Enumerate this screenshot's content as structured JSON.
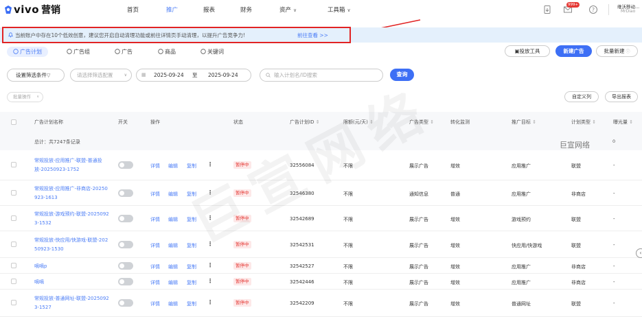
{
  "brand": {
    "logo_text": "vivo",
    "logo_text2": "营销"
  },
  "nav": {
    "items": [
      "首页",
      "推广",
      "报表",
      "财务",
      "资产",
      "工具箱"
    ],
    "notif_badge": "999+",
    "user_name": "维沃移动...",
    "user_sub": "MrDiao"
  },
  "banner": {
    "message": "当前账户中存在10个低效创意，建议您开启自动清理功能或前往详情页手动清理，以提升广告竞争力!",
    "link": "前往查看 >>"
  },
  "tabs": [
    "广告计划",
    "广告组",
    "广告",
    "商品",
    "关键词"
  ],
  "actions": {
    "tool": "投放工具",
    "new_ad": "新建广告",
    "batch_new": "批量新建"
  },
  "filters": {
    "set_condition": "设置筛选条件",
    "config_placeholder": "请选择筛选配置",
    "date_start": "2025-09-24",
    "date_to": "至",
    "date_end": "2025-09-24",
    "search_placeholder": "输入计划名/ID搜索",
    "query": "查询"
  },
  "toolbar": {
    "batch_op": "批量操作",
    "custom_cols": "自定义列",
    "export": "导出报表"
  },
  "table": {
    "headers": [
      "广告计划名称",
      "开关",
      "操作",
      "状态",
      "广告计划ID",
      "限额(元/天)",
      "广告类型",
      "转化监测",
      "推广目标",
      "计划类型",
      "曝光量"
    ],
    "summary": "总计：共7247条记录",
    "summary_zero": "0",
    "op_labels": [
      "详情",
      "编辑",
      "复制"
    ],
    "rows": [
      {
        "name": [
          "常规投放-应用推广-联盟-普通投",
          "放-20250923-1752"
        ],
        "status": "暂停中",
        "id": "32556084",
        "limit": "不限",
        "adtype": "展示广告",
        "conv": "增效",
        "target": "应用推广",
        "plantype": "联盟",
        "exposure": "-"
      },
      {
        "name": [
          "常规投放-应用推广-非商店-20250",
          "923-1613"
        ],
        "status": "暂停中",
        "id": "32546380",
        "limit": "不限",
        "adtype": "通知信息",
        "conv": "普通",
        "target": "应用推广",
        "plantype": "非商店",
        "exposure": "-"
      },
      {
        "name": [
          "常规投放-游戏预约-联盟-2025092",
          "3-1532"
        ],
        "status": "暂停中",
        "id": "32542689",
        "limit": "不限",
        "adtype": "展示广告",
        "conv": "增效",
        "target": "游戏预约",
        "plantype": "联盟",
        "exposure": "-"
      },
      {
        "name": [
          "常规投放-快应用/快游戏-联盟-202",
          "50923-1530"
        ],
        "status": "暂停中",
        "id": "32542531",
        "limit": "不限",
        "adtype": "展示广告",
        "conv": "增效",
        "target": "快应用/快游戏",
        "plantype": "联盟",
        "exposure": "-"
      },
      {
        "name": [
          "嘀嘀p"
        ],
        "status": "暂停中",
        "id": "32542527",
        "limit": "不限",
        "adtype": "展示广告",
        "conv": "增效",
        "target": "应用推广",
        "plantype": "非商店",
        "exposure": "-"
      },
      {
        "name": [
          "嘀嘀"
        ],
        "status": "暂停中",
        "id": "32542446",
        "limit": "不限",
        "adtype": "展示广告",
        "conv": "增效",
        "target": "应用推广",
        "plantype": "非商店",
        "exposure": "-"
      },
      {
        "name": [
          "常规投放-普通网址-联盟-2025092",
          "3-1527"
        ],
        "status": "暂停中",
        "id": "32542209",
        "limit": "不限",
        "adtype": "展示广告",
        "conv": "增效",
        "target": "普通网址",
        "plantype": "联盟",
        "exposure": "-"
      }
    ]
  },
  "watermark": {
    "main": "巨宣网络",
    "small": "巨宣网络"
  }
}
